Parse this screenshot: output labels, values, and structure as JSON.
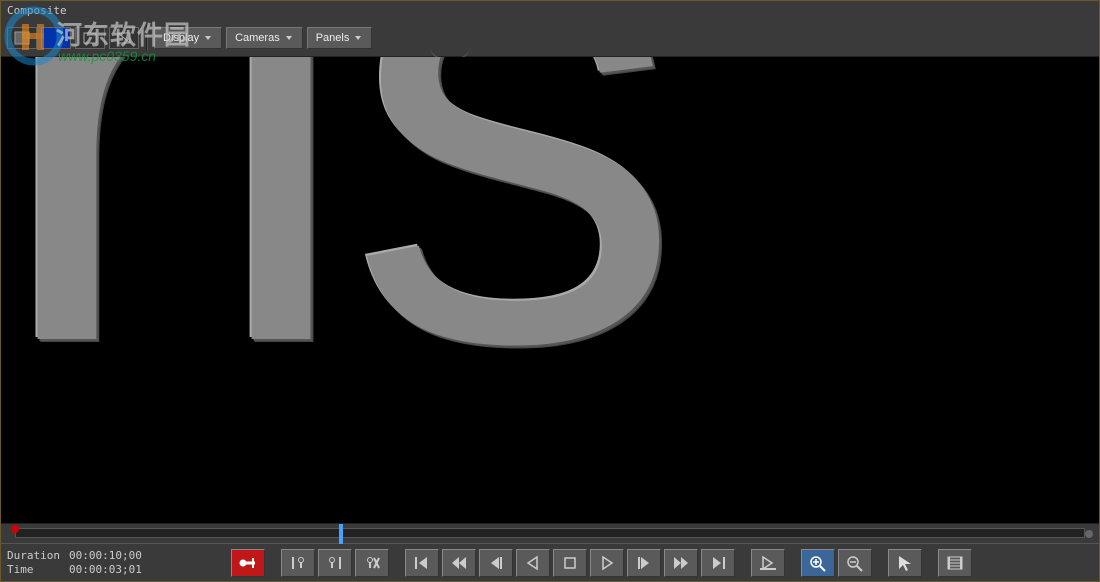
{
  "header": {
    "title": "Composite"
  },
  "watermark": {
    "text": "河东软件园",
    "url": "www.pc0359.cn"
  },
  "toolbar": {
    "display_label": "Display",
    "cameras_label": "Cameras",
    "panels_label": "Panels"
  },
  "viewport": {
    "content": "rıs"
  },
  "timeline": {
    "duration_label": "Duration",
    "duration_value": "00:00:10;00",
    "time_label": "Time",
    "time_value": "00:00:03;01"
  }
}
